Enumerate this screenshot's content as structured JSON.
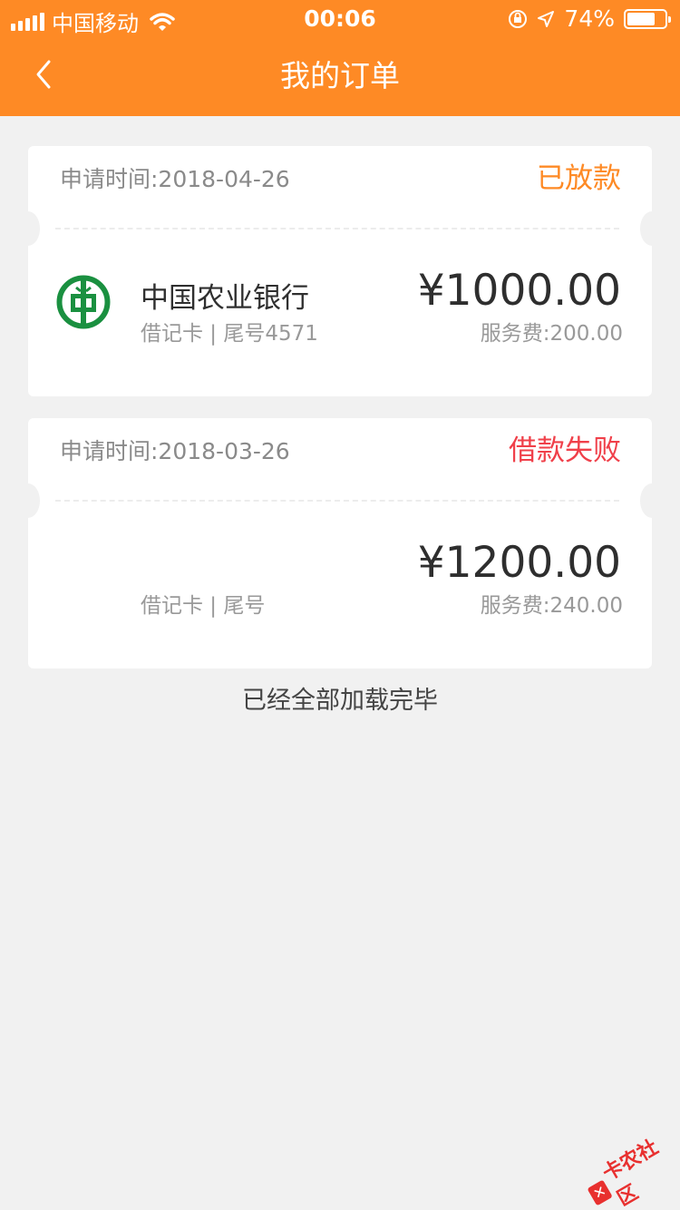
{
  "status_bar": {
    "carrier": "中国移动",
    "time": "00:06",
    "battery_text": "74%",
    "battery_level": 0.74
  },
  "nav": {
    "title": "我的订单"
  },
  "orders": [
    {
      "apply_time": "申请时间:2018-04-26",
      "status": "已放款",
      "status_color": "#fe8a25",
      "bank_name": "中国农业银行",
      "card_type": "借记卡 | 尾号4571",
      "amount": "¥1000.00",
      "fee": "服务费:200.00"
    },
    {
      "apply_time": "申请时间:2018-03-26",
      "status": "借款失败",
      "status_color": "#f0404a",
      "bank_name": "",
      "card_type": "借记卡 | 尾号",
      "amount": "¥1200.00",
      "fee": "服务费:240.00"
    }
  ],
  "footer": {
    "loaded_text": "已经全部加载完毕"
  },
  "watermark": {
    "text": "卡农社区"
  },
  "colors": {
    "header": "#fe8a25",
    "background": "#f1f1f1",
    "abc_green": "#1a9040"
  }
}
